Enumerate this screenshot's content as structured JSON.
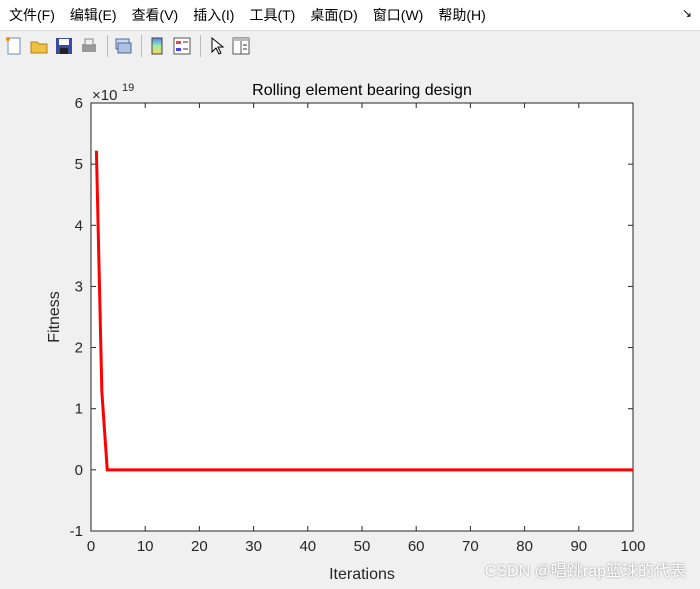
{
  "menu": [
    "文件(F)",
    "编辑(E)",
    "查看(V)",
    "插入(I)",
    "工具(T)",
    "桌面(D)",
    "窗口(W)",
    "帮助(H)"
  ],
  "toolbar": [
    "new-file-icon",
    "open-folder-icon",
    "save-icon",
    "print-icon",
    "link-plot-icon",
    "colorbar-icon",
    "legend-icon",
    "pointer-icon",
    "property-inspector-icon"
  ],
  "watermark": "CSDN @唱跳rap篮球的代表",
  "chart_data": {
    "type": "line",
    "title": "Rolling element bearing design",
    "xlabel": "Iterations",
    "ylabel": "Fitness",
    "y_exponent_label": "×10",
    "y_exponent": "19",
    "xlim": [
      0,
      100
    ],
    "ylim": [
      -1,
      6
    ],
    "xticks": [
      0,
      10,
      20,
      30,
      40,
      50,
      60,
      70,
      80,
      90,
      100
    ],
    "yticks": [
      -1,
      0,
      1,
      2,
      3,
      4,
      5,
      6
    ],
    "grid": false,
    "series": [
      {
        "color": "#ff0000",
        "x": [
          1,
          2,
          3,
          100
        ],
        "y": [
          5.22,
          1.28,
          0,
          0
        ]
      }
    ]
  }
}
